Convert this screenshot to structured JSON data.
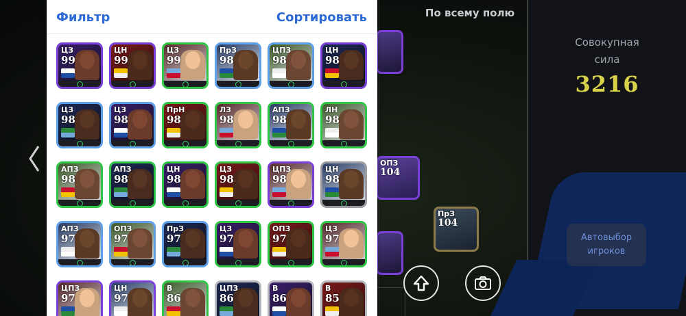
{
  "panel": {
    "filter_label": "Фильтр",
    "sort_label": "Сортировать"
  },
  "pitch": {
    "title": "По всему полю",
    "cards": [
      {
        "position": "",
        "rating": ""
      },
      {
        "position": "ОПЗ",
        "rating": "104"
      },
      {
        "position": "ПрЗ",
        "rating": "104"
      },
      {
        "position": "",
        "rating": ""
      }
    ]
  },
  "summary": {
    "total_label_line1": "Совокупная",
    "total_label_line2": "сила",
    "total_value": "3216"
  },
  "auto_button": {
    "line1": "Автовыбор",
    "line2": "игроков"
  },
  "icons": {
    "upload": "upload-arrow-icon",
    "camera": "camera-icon",
    "back": "chevron-left-icon"
  },
  "players": [
    {
      "position": "ЦЗ",
      "rating": "99",
      "style": "purple"
    },
    {
      "position": "ЦН",
      "rating": "99",
      "style": "purple"
    },
    {
      "position": "ЦЗ",
      "rating": "99",
      "style": "green"
    },
    {
      "position": "ПрЗ",
      "rating": "98",
      "style": "blue"
    },
    {
      "position": "ЦПЗ",
      "rating": "98",
      "style": "blue"
    },
    {
      "position": "ЦН",
      "rating": "98",
      "style": "purple"
    },
    {
      "position": "ЦЗ",
      "rating": "98",
      "style": "blue"
    },
    {
      "position": "ЦЗ",
      "rating": "98",
      "style": "blue"
    },
    {
      "position": "ПрН",
      "rating": "98",
      "style": "green"
    },
    {
      "position": "ЛЗ",
      "rating": "98",
      "style": "green"
    },
    {
      "position": "АПЗ",
      "rating": "98",
      "style": "green"
    },
    {
      "position": "ЛН",
      "rating": "98",
      "style": "green"
    },
    {
      "position": "АПЗ",
      "rating": "98",
      "style": "green"
    },
    {
      "position": "АПЗ",
      "rating": "98",
      "style": "green"
    },
    {
      "position": "ЦН",
      "rating": "98",
      "style": "green"
    },
    {
      "position": "ЦЗ",
      "rating": "98",
      "style": "green"
    },
    {
      "position": "ЦПЗ",
      "rating": "98",
      "style": "purple"
    },
    {
      "position": "ЦН",
      "rating": "98",
      "style": "gray"
    },
    {
      "position": "АПЗ",
      "rating": "97",
      "style": "blue"
    },
    {
      "position": "ОПЗ",
      "rating": "97",
      "style": "blue"
    },
    {
      "position": "ПрЗ",
      "rating": "97",
      "style": "blue"
    },
    {
      "position": "ЦЗ",
      "rating": "97",
      "style": "green"
    },
    {
      "position": "ОПЗ",
      "rating": "97",
      "style": "green"
    },
    {
      "position": "ЦЗ",
      "rating": "97",
      "style": "green"
    },
    {
      "position": "ЦПЗ",
      "rating": "97",
      "style": "purple"
    },
    {
      "position": "ЦН",
      "rating": "97",
      "style": "purple"
    },
    {
      "position": "В",
      "rating": "86",
      "style": "green"
    },
    {
      "position": "ЦПЗ",
      "rating": "86",
      "style": "silver"
    },
    {
      "position": "В",
      "rating": "86",
      "style": "silver"
    },
    {
      "position": "В",
      "rating": "85",
      "style": "silver"
    }
  ]
}
